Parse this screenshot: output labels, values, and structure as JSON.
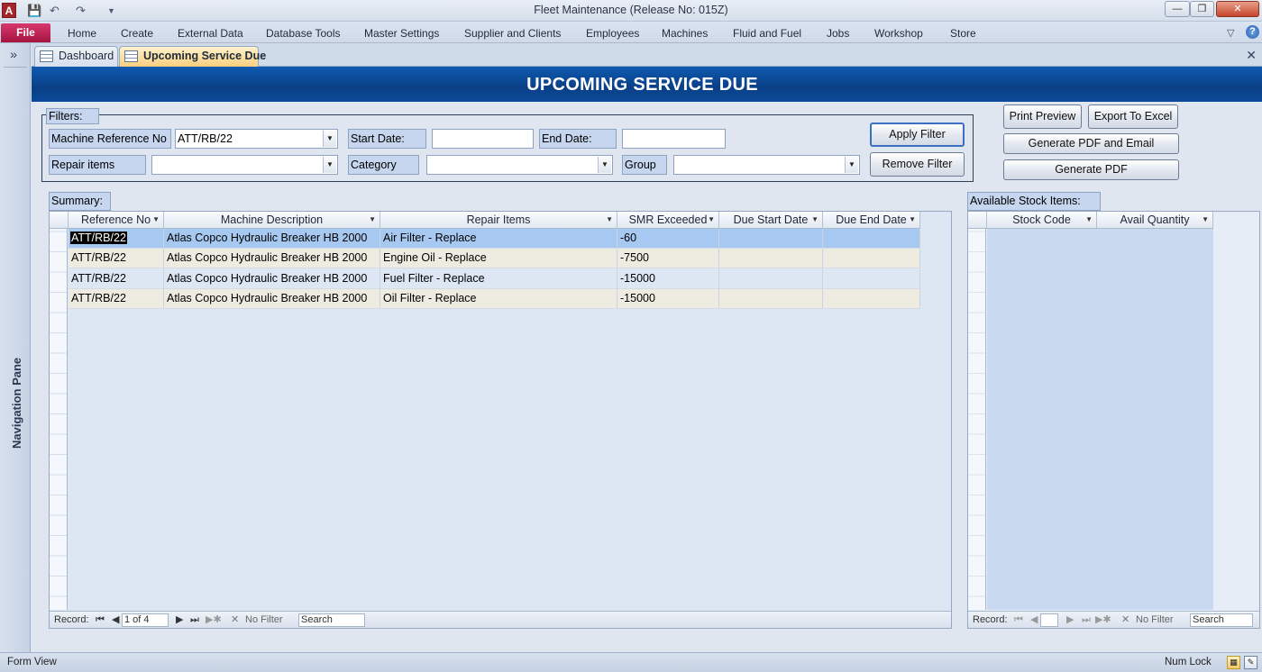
{
  "window": {
    "app_icon": "A",
    "title": "Fleet Maintenance (Release No: 015Z)",
    "quick_access": [
      "save-icon",
      "undo-icon",
      "redo-icon",
      "customize-icon"
    ],
    "controls": [
      "minimize-icon",
      "restore-icon",
      "close-icon"
    ]
  },
  "ribbon": {
    "file_label": "File",
    "tabs": [
      "Home",
      "Create",
      "External Data",
      "Database Tools",
      "Master Settings",
      "Supplier and Clients",
      "Employees",
      "Machines",
      "Fluid and Fuel",
      "Jobs",
      "Workshop",
      "Store"
    ],
    "help": "?"
  },
  "nav_pane": {
    "toggle": "»",
    "label": "Navigation Pane"
  },
  "doc_tabs": [
    {
      "label": "Dashboard",
      "active": false
    },
    {
      "label": "Upcoming Service Due",
      "active": true
    }
  ],
  "form": {
    "title": "UPCOMING SERVICE DUE",
    "filters": {
      "legend": "Filters:",
      "machine_ref_label": "Machine Reference No",
      "machine_ref_value": "ATT/RB/22",
      "start_date_label": "Start Date:",
      "start_date_value": "",
      "end_date_label": "End Date:",
      "end_date_value": "",
      "repair_items_label": "Repair items",
      "repair_items_value": "",
      "category_label": "Category",
      "category_value": "",
      "group_label": "Group",
      "group_value": "",
      "apply_button": "Apply Filter",
      "remove_button": "Remove Filter"
    },
    "actions": {
      "print_preview": "Print Preview",
      "export_excel": "Export To Excel",
      "pdf_email": "Generate PDF and Email",
      "pdf": "Generate PDF"
    },
    "summary": {
      "legend": "Summary:",
      "columns": [
        "Reference No",
        "Machine Description",
        "Repair Items",
        "SMR Exceeded",
        "Due Start Date",
        "Due End Date"
      ],
      "rows": [
        {
          "ref": "ATT/RB/22",
          "desc": "Atlas Copco Hydraulic Breaker HB 2000",
          "item": "Air Filter - Replace",
          "smr": "-60",
          "start": "",
          "end": ""
        },
        {
          "ref": "ATT/RB/22",
          "desc": "Atlas Copco Hydraulic Breaker HB 2000",
          "item": "Engine Oil - Replace",
          "smr": "-7500",
          "start": "",
          "end": ""
        },
        {
          "ref": "ATT/RB/22",
          "desc": "Atlas Copco Hydraulic Breaker HB 2000",
          "item": "Fuel Filter - Replace",
          "smr": "-15000",
          "start": "",
          "end": ""
        },
        {
          "ref": "ATT/RB/22",
          "desc": "Atlas Copco Hydraulic Breaker HB 2000",
          "item": "Oil Filter - Replace",
          "smr": "-15000",
          "start": "",
          "end": ""
        }
      ],
      "nav": {
        "record_label": "Record:",
        "position": "1 of 4",
        "filter": "No Filter",
        "search": "Search"
      }
    },
    "stock": {
      "legend": "Available Stock Items:",
      "columns": [
        "Stock Code",
        "Avail Quantity"
      ],
      "nav": {
        "record_label": "Record:",
        "position": "",
        "filter": "No Filter",
        "search": "Search"
      }
    }
  },
  "status": {
    "left": "Form View",
    "right": "Num Lock"
  },
  "colors": {
    "header_band": "#0a3f86",
    "selected_row": "#a7c9f1",
    "alt_row": "#eeece1",
    "plain_row": "#dde7f4"
  }
}
